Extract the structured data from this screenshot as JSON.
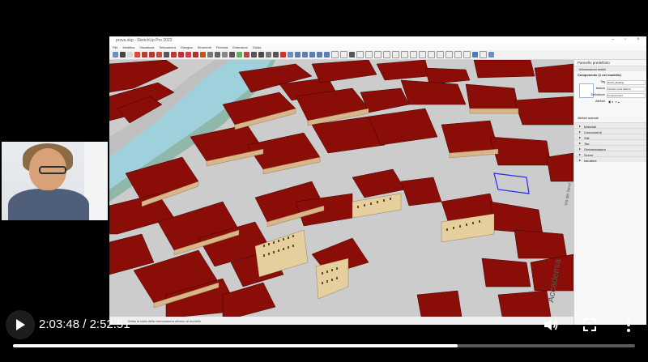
{
  "app": {
    "title": "prova.skp - SketchUp Pro 2022",
    "menus": [
      "File",
      "Modifica",
      "Visualizza",
      "Telecamera",
      "Disegna",
      "Strumenti",
      "Finestra",
      "Estensioni",
      "Guida"
    ]
  },
  "panel": {
    "title": "Pannello predefinito",
    "entity_info_header": "Informazioni entità",
    "component_label": "Componente (1 nel modello)",
    "tag_label": "Tag",
    "tag_value": "3CUS_Building",
    "instance_label": "Istanza",
    "instance_value": "Immetti nome istanza",
    "definition_label": "Definizione",
    "definition_value": "Componente4",
    "toggles_label": "Attributi",
    "advanced_label": "Attributi avanzati",
    "sections": [
      "Materiali",
      "Componenti",
      "Stili",
      "Tag",
      "Ombreggiatura",
      "Scene",
      "Istruttore"
    ]
  },
  "statusbar": {
    "hint": "Orbita la vista della videocamera attorno al modello"
  },
  "video": {
    "current_time": "2:03:48",
    "separator": "/",
    "duration": "2:52:51",
    "progress_fraction": 0.715
  },
  "viewport": {
    "street_label": "Accademia",
    "street_label2": "Via dei Servi"
  }
}
